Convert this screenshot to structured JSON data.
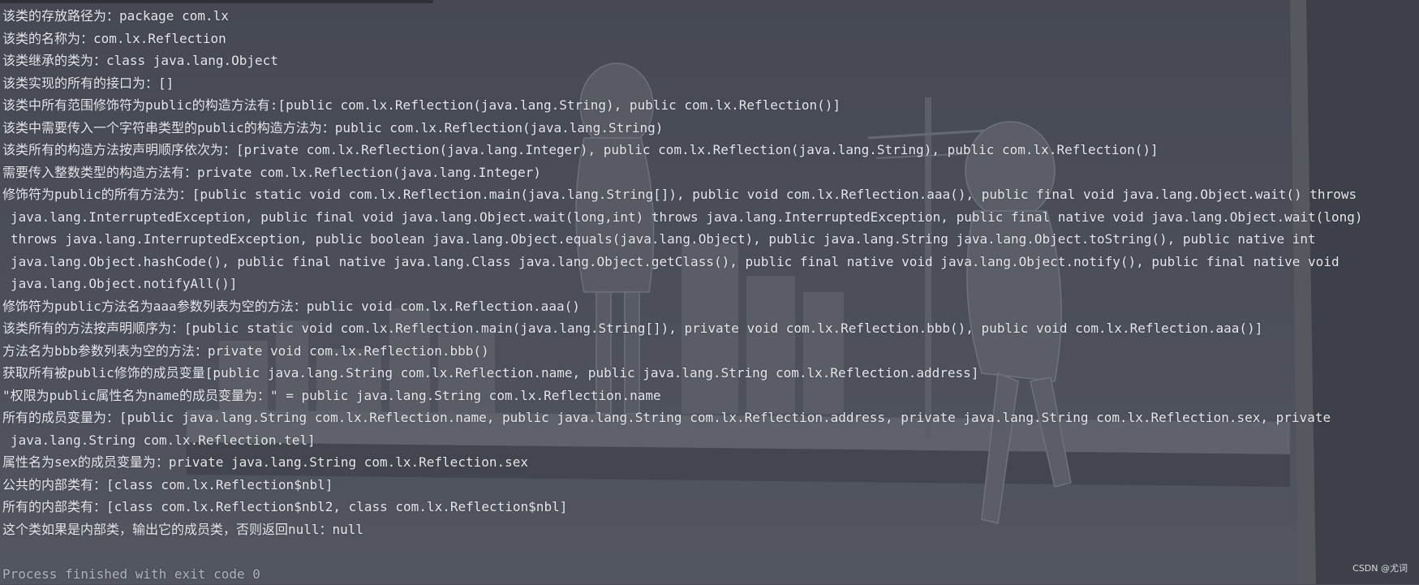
{
  "console": {
    "lines": [
      "该类的存放路径为：package com.lx",
      "该类的名称为：com.lx.Reflection",
      "该类继承的类为：class java.lang.Object",
      "该类实现的所有的接口为：[]",
      "该类中所有范围修饰符为public的构造方法有:[public com.lx.Reflection(java.lang.String), public com.lx.Reflection()]",
      "该类中需要传入一个字符串类型的public的构造方法为：public com.lx.Reflection(java.lang.String)",
      "该类所有的构造方法按声明顺序依次为：[private com.lx.Reflection(java.lang.Integer), public com.lx.Reflection(java.lang.String), public com.lx.Reflection()]",
      "需要传入整数类型的构造方法有：private com.lx.Reflection(java.lang.Integer)",
      "修饰符为public的所有方法为：[public static void com.lx.Reflection.main(java.lang.String[]), public void com.lx.Reflection.aaa(), public final void java.lang.Object.wait() throws",
      "java.lang.InterruptedException, public final void java.lang.Object.wait(long,int) throws java.lang.InterruptedException, public final native void java.lang.Object.wait(long)",
      "throws java.lang.InterruptedException, public boolean java.lang.Object.equals(java.lang.Object), public java.lang.String java.lang.Object.toString(), public native int",
      "java.lang.Object.hashCode(), public final native java.lang.Class java.lang.Object.getClass(), public final native void java.lang.Object.notify(), public final native void",
      "java.lang.Object.notifyAll()]",
      "修饰符为public方法名为aaa参数列表为空的方法：public void com.lx.Reflection.aaa()",
      "该类所有的方法按声明顺序为：[public static void com.lx.Reflection.main(java.lang.String[]), private void com.lx.Reflection.bbb(), public void com.lx.Reflection.aaa()]",
      "方法名为bbb参数列表为空的方法：private void com.lx.Reflection.bbb()",
      "获取所有被public修饰的成员变量[public java.lang.String com.lx.Reflection.name, public java.lang.String com.lx.Reflection.address]",
      "\"权限为public属性名为name的成员变量为：\" = public java.lang.String com.lx.Reflection.name",
      "所有的成员变量为：[public java.lang.String com.lx.Reflection.name, public java.lang.String com.lx.Reflection.address, private java.lang.String com.lx.Reflection.sex, private",
      "java.lang.String com.lx.Reflection.tel]",
      "属性名为sex的成员变量为：private java.lang.String com.lx.Reflection.sex",
      "公共的内部类有：[class com.lx.Reflection$nbl]",
      "所有的内部类有：[class com.lx.Reflection$nbl2, class com.lx.Reflection$nbl]",
      "这个类如果是内部类，输出它的成员类，否则返回null：null",
      "",
      "Process finished with exit code 0"
    ]
  },
  "watermark": "CSDN @尤词"
}
